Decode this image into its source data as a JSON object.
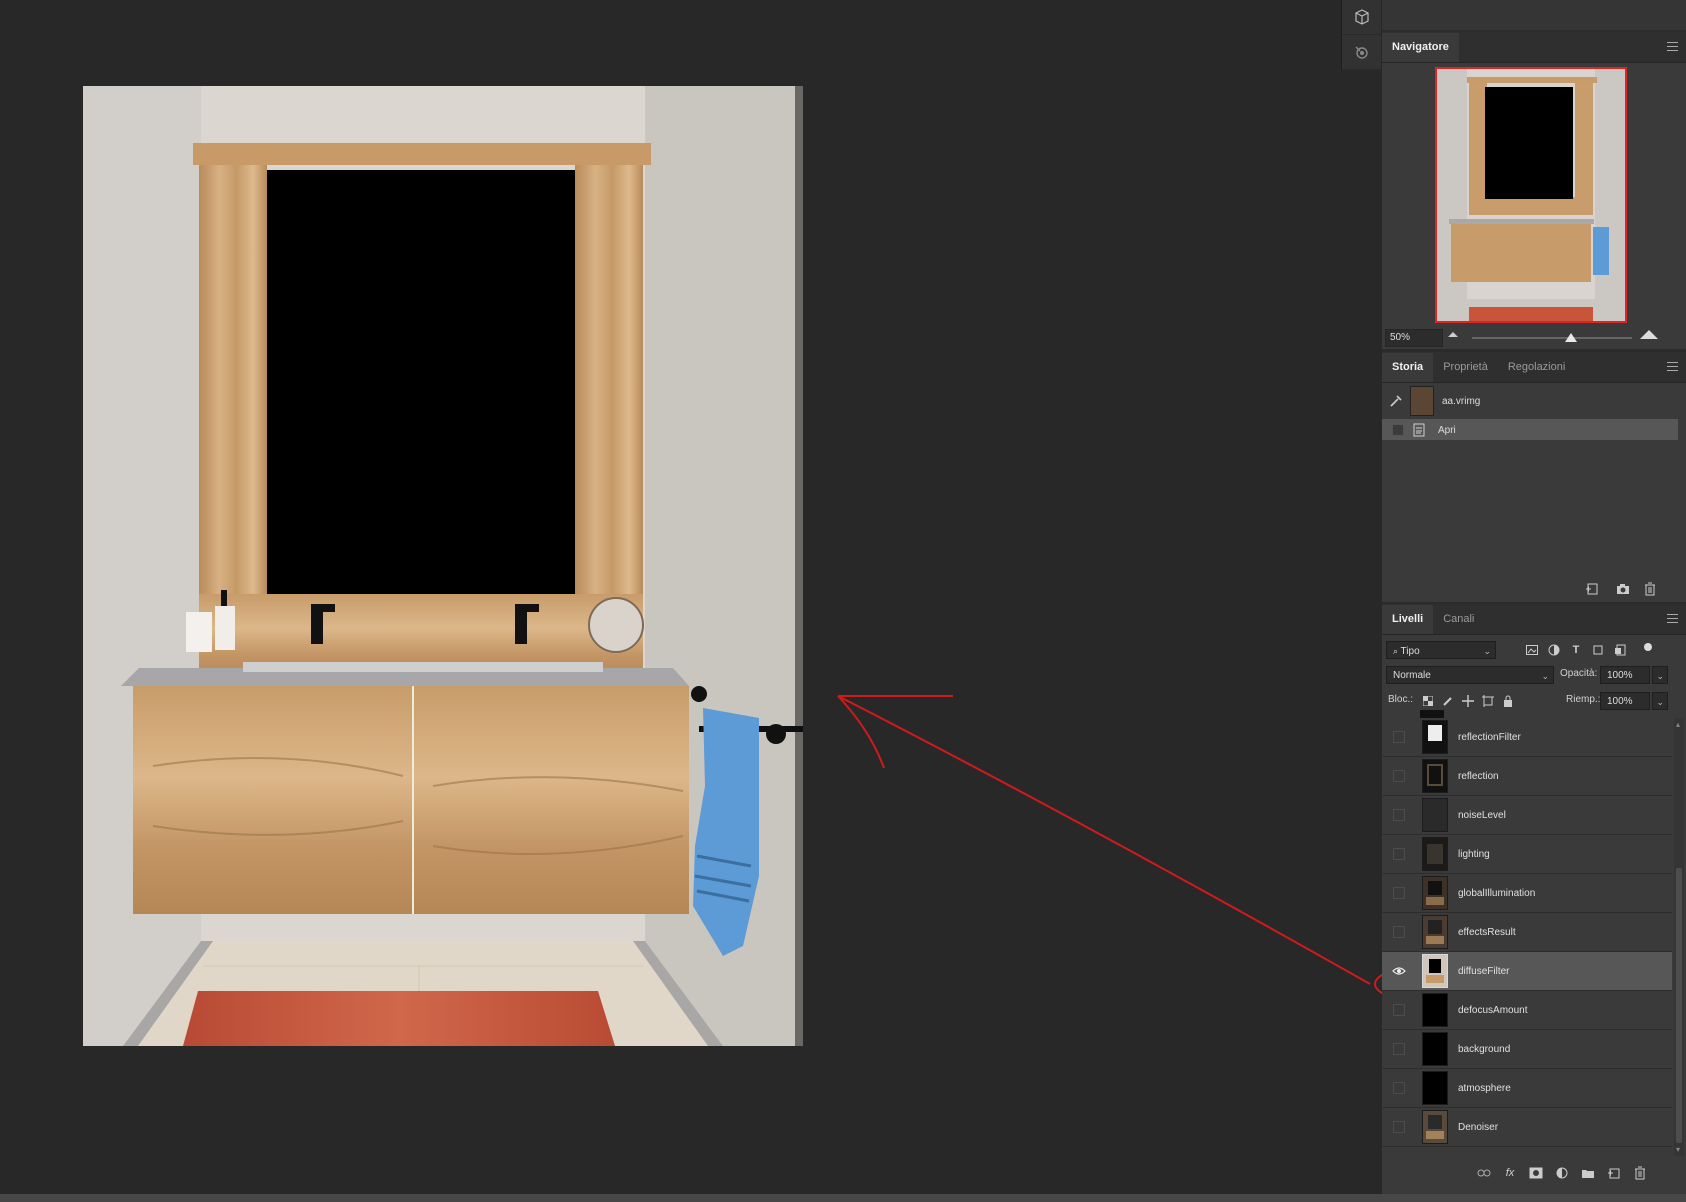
{
  "navigator": {
    "tab_label": "Navigatore",
    "zoom": "50%",
    "zoom_slider_fraction": 0.62
  },
  "history": {
    "tabs": [
      "Storia",
      "Proprietà",
      "Regolazioni"
    ],
    "snapshot_label": "aa.vrimg",
    "items": [
      {
        "label": "Apri"
      }
    ]
  },
  "layers": {
    "tabs": [
      "Livelli",
      "Canali"
    ],
    "filter_kind": "Tipo",
    "blend_mode": "Normale",
    "opacity_label": "Opacità:",
    "opacity": "100%",
    "lock_label": "Bloc.:",
    "fill_label": "Riemp.:",
    "fill": "100%",
    "items": [
      {
        "name": "reflectionFilter",
        "visible": false
      },
      {
        "name": "reflection",
        "visible": false
      },
      {
        "name": "noiseLevel",
        "visible": false
      },
      {
        "name": "lighting",
        "visible": false
      },
      {
        "name": "globalIllumination",
        "visible": false
      },
      {
        "name": "effectsResult",
        "visible": false
      },
      {
        "name": "diffuseFilter",
        "visible": true,
        "selected": true
      },
      {
        "name": "defocusAmount",
        "visible": false
      },
      {
        "name": "background",
        "visible": false
      },
      {
        "name": "atmosphere",
        "visible": false
      },
      {
        "name": "Denoiser",
        "visible": false
      }
    ]
  },
  "colors": {
    "annotation": "#d11a1a",
    "wood": "#c79a68",
    "towel": "#5d9bd6",
    "rug": "#c8553a"
  }
}
